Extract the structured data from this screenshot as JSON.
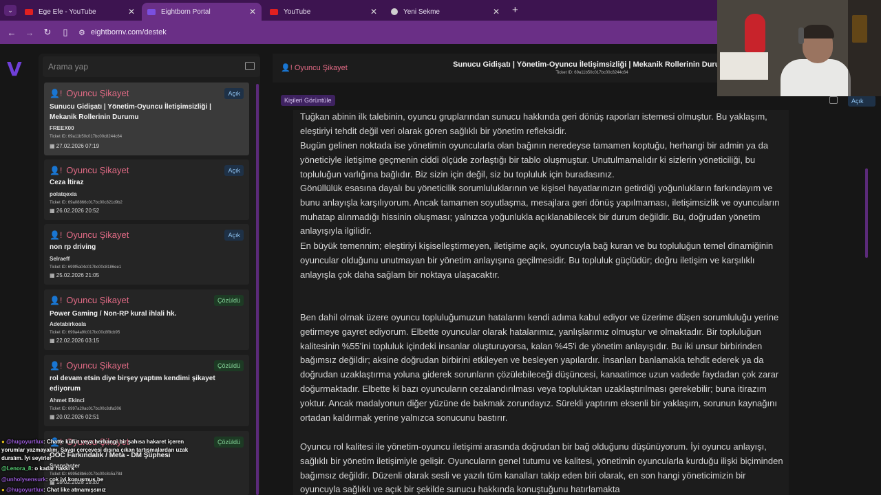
{
  "browser": {
    "tabs": [
      {
        "title": "Ege Efe - YouTube",
        "favicon_color": "#e02020",
        "active": false
      },
      {
        "title": "Eightborn Portal",
        "favicon_color": "#7a4fe0",
        "active": true
      },
      {
        "title": "YouTube",
        "favicon_color": "#e02020",
        "active": false
      },
      {
        "title": "Yeni Sekme",
        "favicon_color": "#cfcfcf",
        "active": false
      }
    ],
    "new_tab": "+",
    "url": "eightbornv.com/destek"
  },
  "sidebar": {
    "logo": "V",
    "search_placeholder": "Arama yap"
  },
  "tickets": [
    {
      "category": "Oyuncu Şikayet",
      "status": "Açık",
      "status_type": "open",
      "title": "Sunucu Gidişatı | Yönetim-Oyuncu İletişimsizliği | Mekanik Rollerinin Durumu",
      "user": "FREEX00",
      "ticket_id": "Ticket ID: 69a11b50c017bc00c8244c64",
      "date": "27.02.2026 07:19",
      "selected": true
    },
    {
      "category": "Oyuncu Şikayet",
      "status": "Açık",
      "status_type": "open",
      "title": "Ceza İtiraz",
      "user": "polatqexia",
      "ticket_id": "Ticket ID: 69a08866c017bc00c821d9b2",
      "date": "26.02.2026 20:52",
      "selected": false
    },
    {
      "category": "Oyuncu Şikayet",
      "status": "Açık",
      "status_type": "open",
      "title": "non rp driving",
      "user": "Selraeff",
      "ticket_id": "Ticket ID: 699f5a04c017bc00c8186ee1",
      "date": "25.02.2026 21:05",
      "selected": false
    },
    {
      "category": "Oyuncu Şikayet",
      "status": "Çözüldü",
      "status_type": "solved",
      "title": "Power Gaming / Non-RP kural ihlali hk.",
      "user": "Adetabirkoala",
      "ticket_id": "Ticket ID: 699a4a9fc017bc00c8f8cb95",
      "date": "22.02.2026 03:15",
      "selected": false
    },
    {
      "category": "Oyuncu Şikayet",
      "status": "Çözüldü",
      "status_type": "solved",
      "title": "rol devam etsin diye birşey yaptım kendimi şikayet ediyorum",
      "user": "Ahmet Ekinci",
      "ticket_id": "Ticket ID: 6997a20ac017bc00c8dfa306",
      "date": "20.02.2026 02:51",
      "selected": false
    },
    {
      "category": "Oyuncu Şikayet",
      "status": "Çözüldü",
      "status_type": "solved",
      "title": "OOC Farkındalık / Meta - DM Şüphesi",
      "user": "Snapshoter",
      "ticket_id": "Ticket ID: 6995d8b6c017bc00c8c5a78d",
      "date": "18.02.2026 18:20",
      "selected": false
    }
  ],
  "main": {
    "category": "Oyuncu Şikayet",
    "title": "Sunucu Gidişatı | Yönetim-Oyuncu İletişimsizliği | Mekanik Rollerinin Durumu",
    "ticket_id": "Ticket ID: 69a11b50c017bc00c8244c64",
    "view_people": "Kişileri Görüntüle",
    "status": "Açık",
    "paragraphs": [
      "Tuğkan abinin ilk talebinin, oyuncu gruplarından sunucu hakkında geri dönüş raporları istemesi olmuştur. Bu yaklaşım, eleştiriyi tehdit değil veri olarak gören sağlıklı bir yönetim refleksidir.",
      "Bugün gelinen noktada ise yönetimin oyuncularla olan bağının neredeyse tamamen koptuğu, herhangi bir admin ya da yöneticiyle iletişime geçmenin ciddi ölçüde zorlaştığı bir tablo oluşmuştur. Unutulmamalıdır ki sizlerin yöneticiliği, bu topluluğun varlığına bağlıdır. Biz sizin için değil, siz bu topluluk için buradasınız.",
      "Gönüllülük esasına dayalı bu yöneticilik sorumluluklarının ve kişisel hayatlarınızın getirdiği yoğunlukların farkındayım ve bunu anlayışla karşılıyorum. Ancak tamamen soyutlaşma, mesajlara geri dönüş yapılmaması, iletişimsizlik ve oyuncuların muhatap alınmadığı hissinin oluşması; yalnızca yoğunlukla açıklanabilecek bir durum değildir. Bu, doğrudan yönetim anlayışıyla ilgilidir.",
      "En büyük temennim; eleştiriyi kişiselleştirmeyen, iletişime açık, oyuncuyla bağ kuran ve bu topluluğun temel dinamiğinin oyuncular olduğunu unutmayan bir yönetim anlayışına geçilmesidir. Bu topluluk güçlüdür; doğru iletişim ve karşılıklı anlayışla çok daha sağlam bir noktaya ulaşacaktır.",
      "Ben dahil olmak üzere oyuncu topluluğumuzun hatalarını kendi adıma kabul ediyor ve üzerime düşen sorumluluğu yerine getirmeye gayret ediyorum. Elbette oyuncular olarak hatalarımız, yanlışlarımız olmuştur ve olmaktadır. Bir topluluğun kalitesinin %55'ini topluluk içindeki insanlar oluşturuyorsa, kalan %45'i de yönetim anlayışıdır. Bu iki unsur birbirinden bağımsız değildir; aksine doğrudan birbirini etkileyen ve besleyen yapılardır. İnsanları banlamakla tehdit ederek ya da doğrudan uzaklaştırma yoluna giderek sorunların çözülebileceği düşüncesi, kanaatimce uzun vadede faydadan çok zarar doğurmaktadır. Elbette ki bazı oyuncuların cezalandırılması veya topluluktan uzaklaştırılması gerekebilir; buna itirazım yoktur. Ancak madalyonun diğer yüzüne de bakmak zorundayız. Sürekli yaptırım eksenli bir yaklaşım, sorunun kaynağını ortadan kaldırmak yerine yalnızca sonucunu bastırır.",
      "Oyuncu rol kalitesi ile yönetim-oyuncu iletişimi arasında doğrudan bir bağ olduğunu düşünüyorum. İyi oyuncu anlayışı, sağlıklı bir yönetim iletişimiyle gelişir. Oyuncuların genel tutumu ve kalitesi, yönetimin oyuncularla kurduğu ilişki biçiminden bağımsız değildir. Düzenli olarak sesli ve yazılı tüm kanalları takip eden biri olarak, en son hangi yöneticimizin bir oyuncuyla sağlıklı ve açık bir şekilde sunucu hakkında konuştuğunu hatırlamakta"
    ]
  },
  "chat": [
    {
      "user": "@hugoyurtlux",
      "text": ": Chatte küfür veya herhangi bir şahısa hakaret içeren yorumlar yazmayalım. Saygı çerçevesi dışına çıkan tartışmalardan uzak duralım. İyi seyirler"
    },
    {
      "user": "@Lenora_8",
      "text": ": o kadar hakkı k"
    },
    {
      "user": "@unholysensurk",
      "text": ": çok iyi konuşmuş be"
    },
    {
      "user": "@hugoyurtlux",
      "text": ": Chat like atmamışsınız"
    }
  ]
}
